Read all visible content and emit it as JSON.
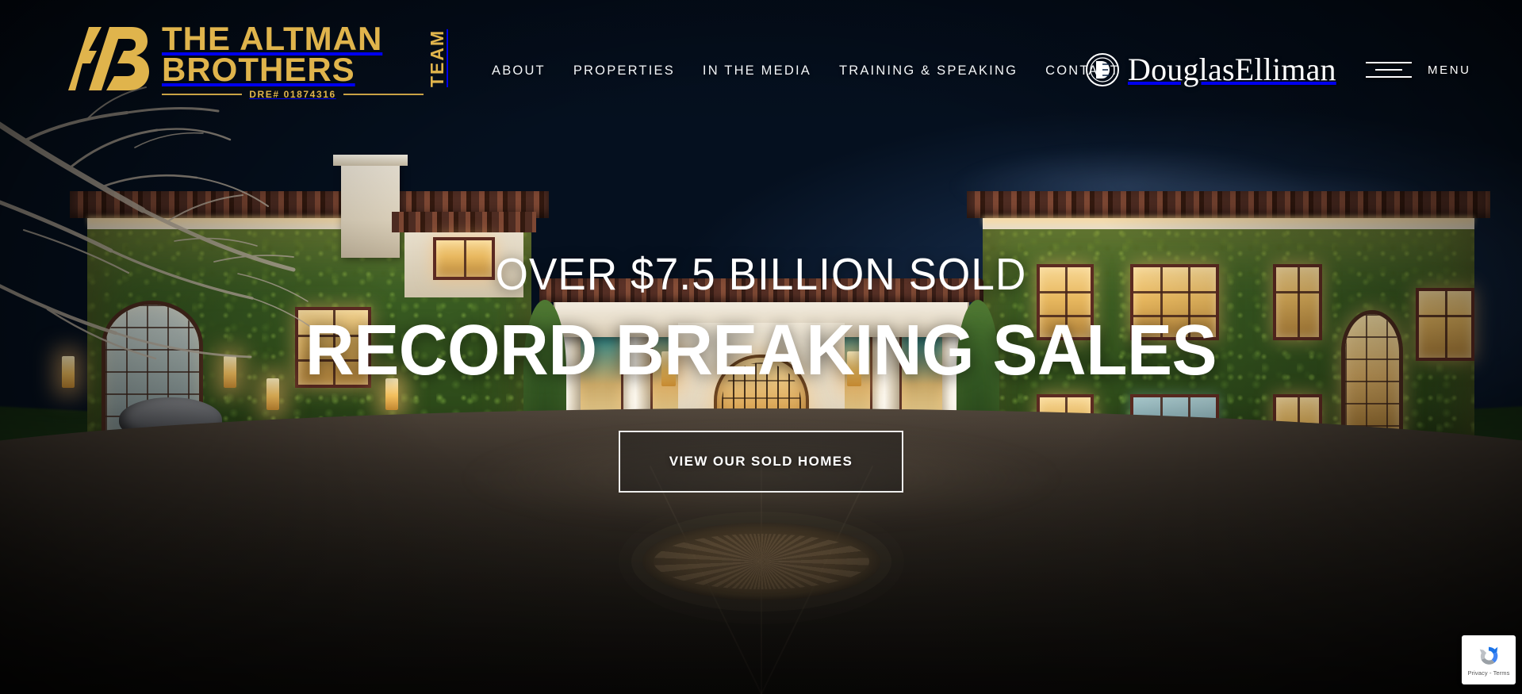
{
  "site": {
    "brand_gold": "#e0b44c",
    "logo": {
      "monogram": "AB",
      "line1": "THE ALTMAN",
      "line2": "BROTHERS",
      "vertical": "TEAM",
      "dre": "DRE# 01874316"
    },
    "brokerage": {
      "name": "DouglasElliman",
      "mark": "de-monogram-icon"
    }
  },
  "nav": {
    "items": [
      {
        "label": "ABOUT"
      },
      {
        "label": "PROPERTIES"
      },
      {
        "label": "IN THE MEDIA"
      },
      {
        "label": "TRAINING & SPEAKING"
      },
      {
        "label": "CONTACT"
      }
    ]
  },
  "menu_button": {
    "label": "MENU",
    "icon": "hamburger-icon"
  },
  "hero": {
    "kicker": "OVER $7.5 BILLION SOLD",
    "title": "RECORD BREAKING SALES",
    "cta": "VIEW OUR SOLD HOMES"
  },
  "recaptcha": {
    "text": "Privacy - Terms",
    "icon": "recaptcha-icon"
  }
}
